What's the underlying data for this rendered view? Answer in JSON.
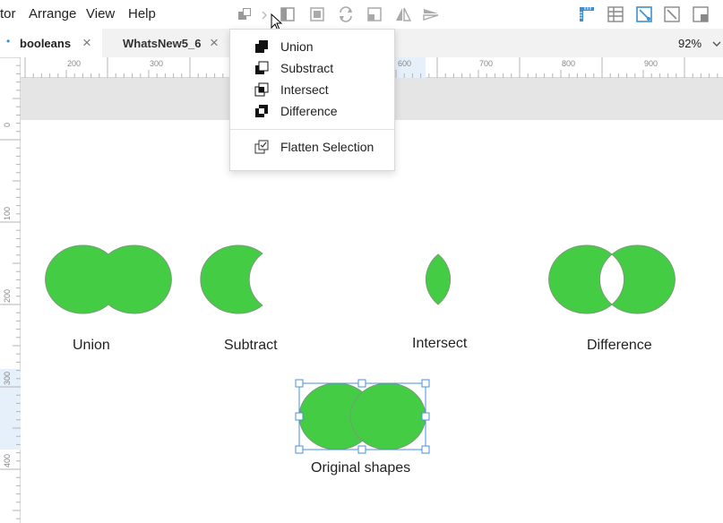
{
  "menubar": {
    "items": [
      "tor",
      "Arrange",
      "View",
      "Help"
    ]
  },
  "tabs": [
    {
      "label": "booleans",
      "close": "×",
      "modified_marker": "•"
    },
    {
      "label": "WhatsNew5_6",
      "close": "×"
    }
  ],
  "zoom": {
    "value": "92%",
    "chevron": "⌄"
  },
  "ruler": {
    "horizontal": [
      "200",
      "300",
      "600",
      "700",
      "800",
      "900"
    ],
    "vertical": [
      "0",
      "100",
      "200",
      "300",
      "400"
    ]
  },
  "boolean_menu": {
    "items": [
      {
        "label": "Union",
        "icon": "union-icon"
      },
      {
        "label": "Substract",
        "icon": "subtract-icon"
      },
      {
        "label": "Intersect",
        "icon": "intersect-icon"
      },
      {
        "label": "Difference",
        "icon": "difference-icon"
      }
    ],
    "flatten": {
      "label": "Flatten Selection",
      "icon": "flatten-icon"
    }
  },
  "canvas": {
    "labels": {
      "union": "Union",
      "subtract": "Subtract",
      "intersect": "Intersect",
      "difference": "Difference",
      "original": "Original shapes"
    }
  },
  "colors": {
    "shape_fill": "#44cc44",
    "shape_stroke": "#7a9a7a",
    "selection": "#4a90d9",
    "accent_icon": "#3d8fd1"
  }
}
